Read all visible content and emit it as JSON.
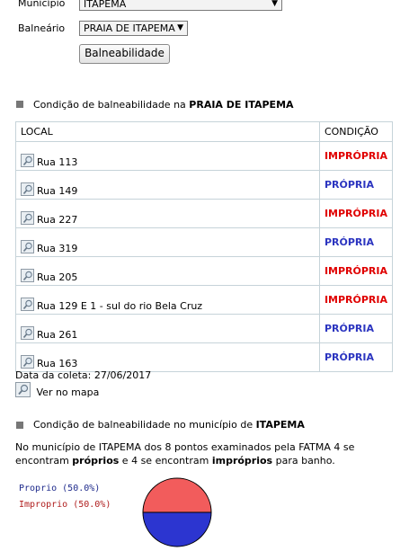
{
  "filters": {
    "municipio_label": "Município",
    "municipio_value": "ITAPEMA",
    "balneario_label": "Balneário",
    "balneario_value": "PRAIA DE ITAPEMA",
    "submit_label": "Balneabilidade"
  },
  "section1": {
    "prefix": "Condição de balneabilidade na ",
    "beach": "PRAIA DE ITAPEMA"
  },
  "table": {
    "col_local": "LOCAL",
    "col_condicao": "CONDIÇÃO",
    "rows": [
      {
        "local": "Rua 113",
        "condicao": "IMPRÓPRIA"
      },
      {
        "local": "Rua 149",
        "condicao": "PRÓPRIA"
      },
      {
        "local": "Rua 227",
        "condicao": "IMPRÓPRIA"
      },
      {
        "local": "Rua 319",
        "condicao": "PRÓPRIA"
      },
      {
        "local": "Rua 205",
        "condicao": "IMPRÓPRIA"
      },
      {
        "local": "Rua 129 E 1 - sul do rio Bela Cruz",
        "condicao": "IMPRÓPRIA"
      },
      {
        "local": "Rua 261",
        "condicao": "PRÓPRIA"
      },
      {
        "local": "Rua 163",
        "condicao": "PRÓPRIA"
      }
    ]
  },
  "collection": {
    "label": "Data da coleta: 27/06/2017",
    "map_link": "Ver no mapa"
  },
  "section2": {
    "prefix": "Condição de balneabilidade no município de ",
    "municipio": "ITAPEMA",
    "summary_1": "No município de ITAPEMA dos 8 pontos examinados pela FATMA 4 se encontram ",
    "summary_bold1": "próprios",
    "summary_2": " e 4 se encontram ",
    "summary_bold2": "impróprios",
    "summary_3": " para banho."
  },
  "chart_data": {
    "type": "pie",
    "slices": [
      {
        "label": "Proprio (50.0%)",
        "value": 50.0,
        "color": "#2c35d0"
      },
      {
        "label": "Improprio (50.0%)",
        "value": 50.0,
        "color": "#f25c5c"
      }
    ]
  },
  "colors": {
    "impropria": "#e00000",
    "propria": "#2c35c0"
  }
}
